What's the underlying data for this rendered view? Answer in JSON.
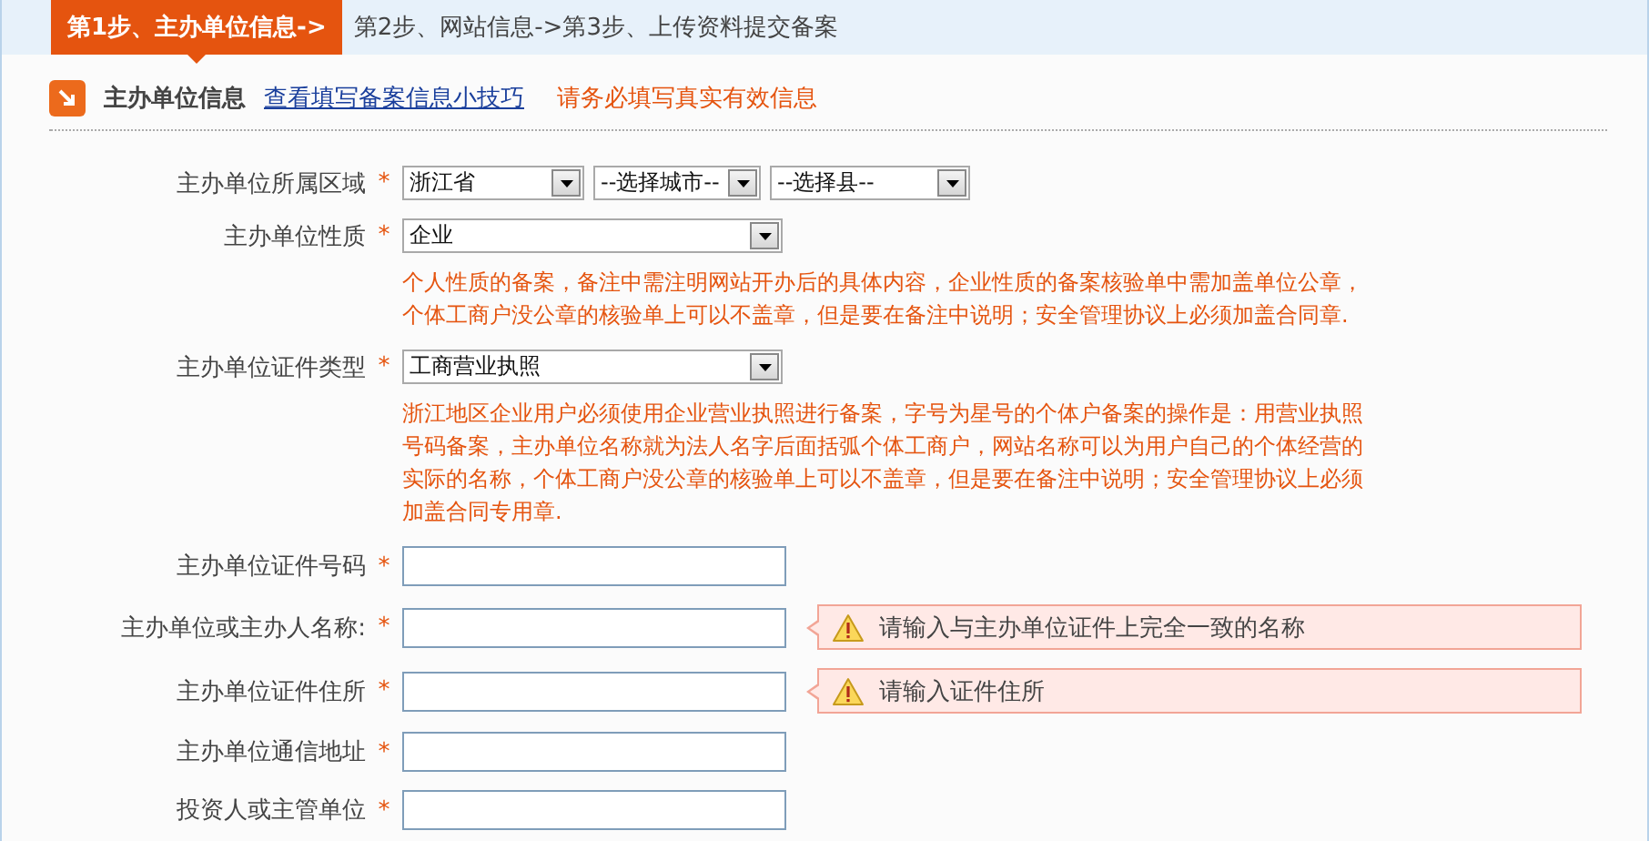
{
  "steps": [
    {
      "label": "第1步、主办单位信息->",
      "selected": true
    },
    {
      "label": "第2步、网站信息->",
      "selected": false
    },
    {
      "label": "第3步、上传资料提交备案",
      "selected": false
    }
  ],
  "section": {
    "title": "主办单位信息",
    "link": "查看填写备案信息小技巧",
    "notice": "请务必填写真实有效信息"
  },
  "fields": [
    {
      "label": "主办单位所属区域",
      "mark": "*",
      "kind": "select",
      "selects": [
        {
          "value": "浙江省"
        },
        {
          "value": "--选择城市--"
        },
        {
          "value": "--选择县--"
        }
      ]
    },
    {
      "label": "主办单位性质",
      "mark": "*",
      "kind": "select",
      "selects": [
        {
          "value": "企业"
        }
      ],
      "note": "个人性质的备案，备注中需注明网站开办后的具体内容，企业性质的备案核验单中需加盖单位公章，个体工商户没公章的核验单上可以不盖章，但是要在备注中说明；安全管理协议上必须加盖合同章."
    },
    {
      "label": "主办单位证件类型",
      "mark": "*",
      "kind": "select",
      "selects": [
        {
          "value": "工商营业执照"
        }
      ],
      "note": "浙江地区企业用户必须使用企业营业执照进行备案，字号为星号的个体户备案的操作是：用营业执照号码备案，主办单位名称就为法人名字后面括弧个体工商户，网站名称可以为用户自己的个体经营的实际的名称，个体工商户没公章的核验单上可以不盖章，但是要在备注中说明；安全管理协议上必须加盖合同专用章."
    },
    {
      "label": "主办单位证件号码",
      "mark": "*",
      "kind": "input"
    },
    {
      "label": "主办单位或主办人名称:",
      "mark": "*",
      "kind": "input",
      "error": "请输入与主办单位证件上完全一致的名称"
    },
    {
      "label": "主办单位证件住所",
      "mark": "*",
      "kind": "input",
      "error": "请输入证件住所"
    },
    {
      "label": "主办单位通信地址",
      "mark": "*",
      "kind": "input"
    },
    {
      "label": "投资人或主管单位",
      "mark": "*",
      "kind": "input"
    }
  ]
}
